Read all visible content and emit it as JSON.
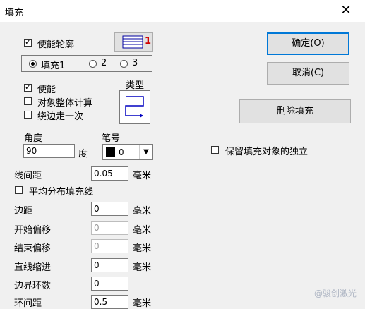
{
  "window": {
    "title": "填充",
    "close_icon": "close-icon"
  },
  "outline": {
    "enable_label": "使能轮廓",
    "enabled": true,
    "pen_button_value": "1",
    "pen_color": "#d00000"
  },
  "fill_tabs": {
    "options": [
      "填充1",
      "2",
      "3"
    ],
    "selected": 0
  },
  "fill": {
    "enable_label": "使能",
    "enabled": true,
    "whole_calc_label": "对象整体计算",
    "whole_calc": false,
    "edge_once_label": "绕边走一次",
    "edge_once": false,
    "type_label": "类型",
    "angle_label": "角度",
    "angle_value": "90",
    "angle_unit": "度",
    "pen_label": "笔号",
    "pen_value": "0",
    "line_spacing_label": "线间距",
    "line_spacing_value": "0.05",
    "line_spacing_unit": "毫米",
    "average_label": "平均分布填充线",
    "average": false,
    "margin_label": "边距",
    "margin_value": "0",
    "margin_unit": "毫米",
    "start_offset_label": "开始偏移",
    "start_offset_value": "0",
    "start_offset_unit": "毫米",
    "end_offset_label": "结束偏移",
    "end_offset_value": "0",
    "end_offset_unit": "毫米",
    "line_shrink_label": "直线缩进",
    "line_shrink_value": "0",
    "line_shrink_unit": "毫米",
    "border_loops_label": "边界环数",
    "border_loops_value": "0",
    "loop_spacing_label": "环间距",
    "loop_spacing_value": "0.5",
    "loop_spacing_unit": "毫米"
  },
  "buttons": {
    "ok": "确定(O)",
    "cancel": "取消(C)",
    "delete_fill": "删除填充"
  },
  "keep_independent": {
    "label": "保留填充对象的独立",
    "checked": false
  },
  "watermark": "@骏创激光"
}
